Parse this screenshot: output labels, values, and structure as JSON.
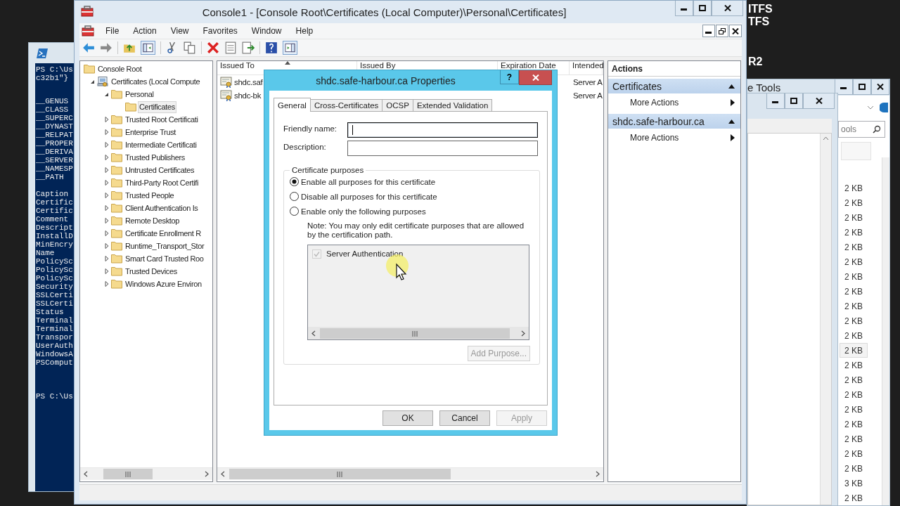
{
  "desktop_text": [
    "ITFS",
    "TFS",
    "R2"
  ],
  "powershell": {
    "blocks": [
      [
        "PS C:\\Us",
        "c32b1\"}"
      ],
      [
        "__GENUS",
        "__CLASS",
        "__SUPERC",
        "__DYNAST",
        "__RELPAT",
        "__PROPER",
        "__DERIVA",
        "__SERVER",
        "__NAMESP",
        "__PATH"
      ],
      [
        "Caption",
        "Certific",
        "Certific",
        "Comment",
        "Descript",
        "InstallD",
        "MinEncry",
        "Name",
        "PolicySc",
        "PolicySc",
        "PolicySc",
        "Security",
        "SSLCerti",
        "SSLCerti",
        "Status",
        "Terminal",
        "Terminal",
        "Transpor",
        "UserAuth",
        "WindowsA",
        "PSComput"
      ],
      [
        "PS C:\\Us"
      ]
    ]
  },
  "explorer": {
    "title": "e Tools",
    "search_placeholder": "ools",
    "sizes": [
      {
        "text": "2 KB",
        "selected": false
      },
      {
        "text": "2 KB",
        "selected": false
      },
      {
        "text": "2 KB",
        "selected": false
      },
      {
        "text": "2 KB",
        "selected": false
      },
      {
        "text": "2 KB",
        "selected": false
      },
      {
        "text": "2 KB",
        "selected": false
      },
      {
        "text": "2 KB",
        "selected": false
      },
      {
        "text": "2 KB",
        "selected": false
      },
      {
        "text": "2 KB",
        "selected": false
      },
      {
        "text": "2 KB",
        "selected": false
      },
      {
        "text": "2 KB",
        "selected": false
      },
      {
        "text": "2 KB",
        "selected": true
      },
      {
        "text": "2 KB",
        "selected": false
      },
      {
        "text": "2 KB",
        "selected": false
      },
      {
        "text": "2 KB",
        "selected": false
      },
      {
        "text": "2 KB",
        "selected": false
      },
      {
        "text": "2 KB",
        "selected": false
      },
      {
        "text": "2 KB",
        "selected": false
      },
      {
        "text": "2 KB",
        "selected": false
      },
      {
        "text": "2 KB",
        "selected": false
      },
      {
        "text": "3 KB",
        "selected": false
      },
      {
        "text": "2 KB",
        "selected": false
      }
    ]
  },
  "mmc": {
    "title": "Console1 - [Console Root\\Certificates (Local Computer)\\Personal\\Certificates]",
    "menu": [
      "File",
      "Action",
      "View",
      "Favorites",
      "Window",
      "Help"
    ],
    "tree": [
      {
        "label": "Console Root",
        "kind": "folder",
        "selected": false,
        "children": [
          {
            "label": "Certificates (Local Compute",
            "kind": "snapin",
            "expanded": true,
            "selected": false,
            "children": [
              {
                "label": "Personal",
                "kind": "folder",
                "expanded": true,
                "selected": false,
                "children": [
                  {
                    "label": "Certificates",
                    "kind": "folder",
                    "selected": true
                  }
                ]
              },
              {
                "label": "Trusted Root Certificati",
                "kind": "folder",
                "expanded": false,
                "selected": false
              },
              {
                "label": "Enterprise Trust",
                "kind": "folder",
                "expanded": false,
                "selected": false
              },
              {
                "label": "Intermediate Certificati",
                "kind": "folder",
                "expanded": false,
                "selected": false
              },
              {
                "label": "Trusted Publishers",
                "kind": "folder",
                "expanded": false,
                "selected": false
              },
              {
                "label": "Untrusted Certificates",
                "kind": "folder",
                "expanded": false,
                "selected": false
              },
              {
                "label": "Third-Party Root Certifi",
                "kind": "folder",
                "expanded": false,
                "selected": false
              },
              {
                "label": "Trusted People",
                "kind": "folder",
                "expanded": false,
                "selected": false
              },
              {
                "label": "Client Authentication Is",
                "kind": "folder",
                "expanded": false,
                "selected": false
              },
              {
                "label": "Remote Desktop",
                "kind": "folder",
                "expanded": false,
                "selected": false
              },
              {
                "label": "Certificate Enrollment R",
                "kind": "folder",
                "expanded": false,
                "selected": false
              },
              {
                "label": "Runtime_Transport_Stor",
                "kind": "folder",
                "expanded": false,
                "selected": false
              },
              {
                "label": "Smart Card Trusted Roo",
                "kind": "folder",
                "expanded": false,
                "selected": false
              },
              {
                "label": "Trusted Devices",
                "kind": "folder",
                "expanded": false,
                "selected": false
              },
              {
                "label": "Windows Azure Environ",
                "kind": "folder",
                "expanded": false,
                "selected": false
              }
            ]
          }
        ]
      }
    ],
    "list": {
      "columns": [
        {
          "label": "Issued To",
          "sorted": true
        },
        {
          "label": "Issued By",
          "sorted": false
        },
        {
          "label": "Expiration Date",
          "sorted": false
        },
        {
          "label": "Intended",
          "sorted": false
        }
      ],
      "rows": [
        {
          "issued_to": "shdc.saf",
          "intended": "Server A"
        },
        {
          "issued_to": "shdc-bk",
          "intended": "Server A"
        }
      ]
    },
    "actions": {
      "header": "Actions",
      "sections": [
        {
          "title": "Certificates",
          "items": [
            "More Actions"
          ]
        },
        {
          "title": "shdc.safe-harbour.ca",
          "items": [
            "More Actions"
          ]
        }
      ]
    }
  },
  "dialog": {
    "title": "shdc.safe-harbour.ca Properties",
    "help": "?",
    "tabs": [
      {
        "label": "General",
        "selected": true
      },
      {
        "label": "Cross-Certificates",
        "selected": false
      },
      {
        "label": "OCSP",
        "selected": false
      },
      {
        "label": "Extended Validation",
        "selected": false
      }
    ],
    "fields": [
      {
        "label": "Friendly name:",
        "focused": true
      },
      {
        "label": "Description:",
        "focused": false
      }
    ],
    "purposes": {
      "title": "Certificate purposes",
      "radios": [
        {
          "label": "Enable all purposes for this certificate",
          "selected": true
        },
        {
          "label": "Disable all purposes for this certificate",
          "selected": false
        },
        {
          "label": "Enable only the following purposes",
          "selected": false
        }
      ],
      "note": "Note: You may only edit certificate purposes that are allowed by the certification path.",
      "items": [
        {
          "label": "Server Authentication",
          "checked": true,
          "disabled": true
        }
      ],
      "add_button": {
        "label": "Add Purpose...",
        "disabled": true
      }
    },
    "buttons": [
      {
        "label": "OK",
        "disabled": false
      },
      {
        "label": "Cancel",
        "disabled": false
      },
      {
        "label": "Apply",
        "disabled": true
      }
    ]
  }
}
